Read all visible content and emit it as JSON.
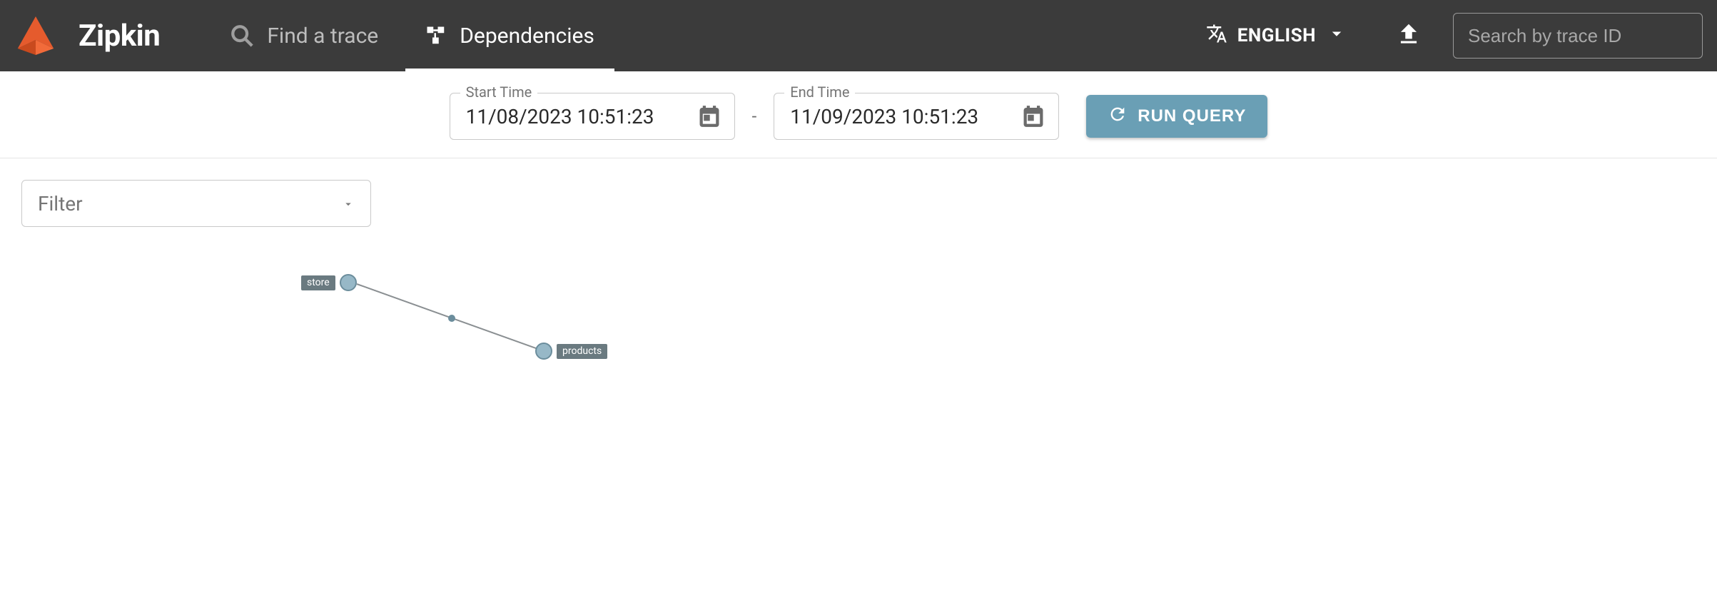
{
  "app": {
    "name": "Zipkin"
  },
  "nav": {
    "find_trace": "Find a trace",
    "dependencies": "Dependencies"
  },
  "language": {
    "label": "ENGLISH"
  },
  "search": {
    "placeholder": "Search by trace ID"
  },
  "time": {
    "start_label": "Start Time",
    "start_value": "11/08/2023 10:51:23",
    "end_label": "End Time",
    "end_value": "11/09/2023 10:51:23",
    "run_label": "RUN QUERY"
  },
  "filter": {
    "placeholder": "Filter"
  },
  "graph": {
    "nodes": [
      {
        "id": "store",
        "label": "store"
      },
      {
        "id": "products",
        "label": "products"
      }
    ],
    "edges": [
      {
        "from": "store",
        "to": "products"
      }
    ]
  },
  "chart_data": {
    "type": "diagram",
    "nodes": [
      "store",
      "products"
    ],
    "edges": [
      [
        "store",
        "products"
      ]
    ],
    "title": "",
    "xlabel": "",
    "ylabel": ""
  }
}
